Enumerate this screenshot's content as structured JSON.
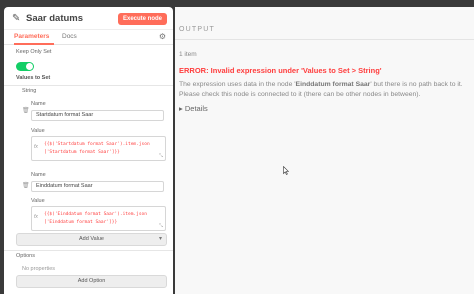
{
  "node": {
    "title": "Saar datums",
    "execute_label": "Execute node",
    "tabs": [
      {
        "label": "Parameters"
      },
      {
        "label": "Docs"
      }
    ],
    "keep_only_set_label": "Keep Only Set",
    "keep_only_set_value": true,
    "values_to_set_label": "Values to Set",
    "string_label": "String",
    "entries": [
      {
        "name_label": "Name",
        "name_value": "Startdatum format Saar",
        "value_label": "Value",
        "expr_lines": [
          "{{$('Startdatum format Saar').item.json",
          "['Startdatum format Saar']}}"
        ]
      },
      {
        "name_label": "Name",
        "name_value": "Einddatum format Saar",
        "value_label": "Value",
        "expr_lines": [
          "{{$('Einddatum format Saar').item.json",
          "['Einddatum format Saar']}}"
        ]
      }
    ],
    "add_value_label": "Add Value",
    "options_label": "Options",
    "no_properties_label": "No properties",
    "add_option_label": "Add Option"
  },
  "output": {
    "title": "OUTPUT",
    "count": "1 item",
    "error_title": "ERROR: Invalid expression under 'Values to Set > String'",
    "error_msg_1": "The expression uses data in the node '",
    "error_msg_node": "Einddatum format Saar",
    "error_msg_2": "' but there is no path back to it. Please check this node is connected to it (there can be other nodes in between).",
    "details_label": "Details"
  },
  "colors": {
    "accent": "#ff6d5a",
    "toggle_on": "#13ce66",
    "error": "#ff3d3d"
  },
  "icons": [
    "pencil-icon",
    "gear-icon",
    "trash-icon",
    "chevron-down-icon",
    "chevron-right-icon",
    "fx-icon",
    "mouse-cursor-icon"
  ]
}
